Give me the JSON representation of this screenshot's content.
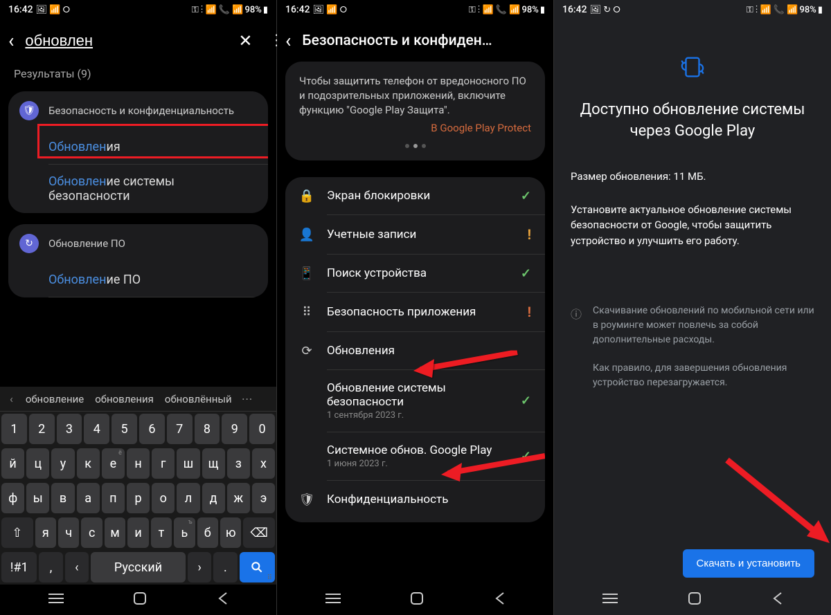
{
  "status": {
    "time": "16:42",
    "battery": "98%"
  },
  "screen1": {
    "searchValue": "обновлен",
    "resultsLabel": "Результаты (9)",
    "group1": {
      "title": "Безопасность и конфиденциальность",
      "item1": {
        "hl": "Обновлен",
        "rest": "ия"
      },
      "item2": {
        "hl": "Обновлен",
        "rest": "ие системы безопасности"
      }
    },
    "group2": {
      "title": "Обновление ПО",
      "item1": {
        "hl": "Обновлен",
        "rest": "ие ПО"
      }
    },
    "suggestions": [
      "обновление",
      "обновления",
      "обновлённый"
    ],
    "spaceLabel": "Русский",
    "symKey": "!#1"
  },
  "screen2": {
    "title": "Безопасность и конфиден…",
    "card": {
      "text": "Чтобы защитить телефон от вредоносного ПО и подозрительных приложений, включите функцию \"Google Play Защита\".",
      "link": "В Google Play Protect"
    },
    "rows": [
      {
        "label": "Экран блокировки",
        "status": "ok"
      },
      {
        "label": "Учетные записи",
        "status": "warn"
      },
      {
        "label": "Поиск устройства",
        "status": "ok"
      },
      {
        "label": "Безопасность приложения",
        "status": "warn2"
      },
      {
        "label": "Обновления"
      }
    ],
    "subRows": [
      {
        "label": "Обновление системы безопасности",
        "sub": "1 сентября 2023 г.",
        "status": "ok"
      },
      {
        "label": "Системное обнов. Google Play",
        "sub": "1 июня 2023 г.",
        "status": "ok"
      }
    ],
    "lastRow": {
      "label": "Конфиденциальность"
    }
  },
  "screen3": {
    "title": "Доступно обновление системы через Google Play",
    "size": "Размер обновления: 11 МБ.",
    "desc": "Установите актуальное обновление системы безопасности от Google, чтобы защитить устройство и улучшить его работу.",
    "info1": "Скачивание обновлений по мобильной сети или в роуминге может повлечь за собой дополнительные расходы.",
    "info2": "Как правило, для завершения обновления устройство перезагружается.",
    "button": "Скачать и установить"
  },
  "kbRows": {
    "r1": [
      "1",
      "2",
      "3",
      "4",
      "5",
      "6",
      "7",
      "8",
      "9",
      "0"
    ],
    "r2": [
      "й",
      "ц",
      "у",
      "к",
      "е",
      "н",
      "г",
      "ш",
      "щ",
      "з",
      "х"
    ],
    "r3": [
      "ф",
      "ы",
      "в",
      "а",
      "п",
      "р",
      "о",
      "л",
      "д",
      "ж",
      "э"
    ],
    "r4": [
      "я",
      "ч",
      "с",
      "м",
      "и",
      "т",
      "ь",
      "б",
      "ю"
    ]
  }
}
